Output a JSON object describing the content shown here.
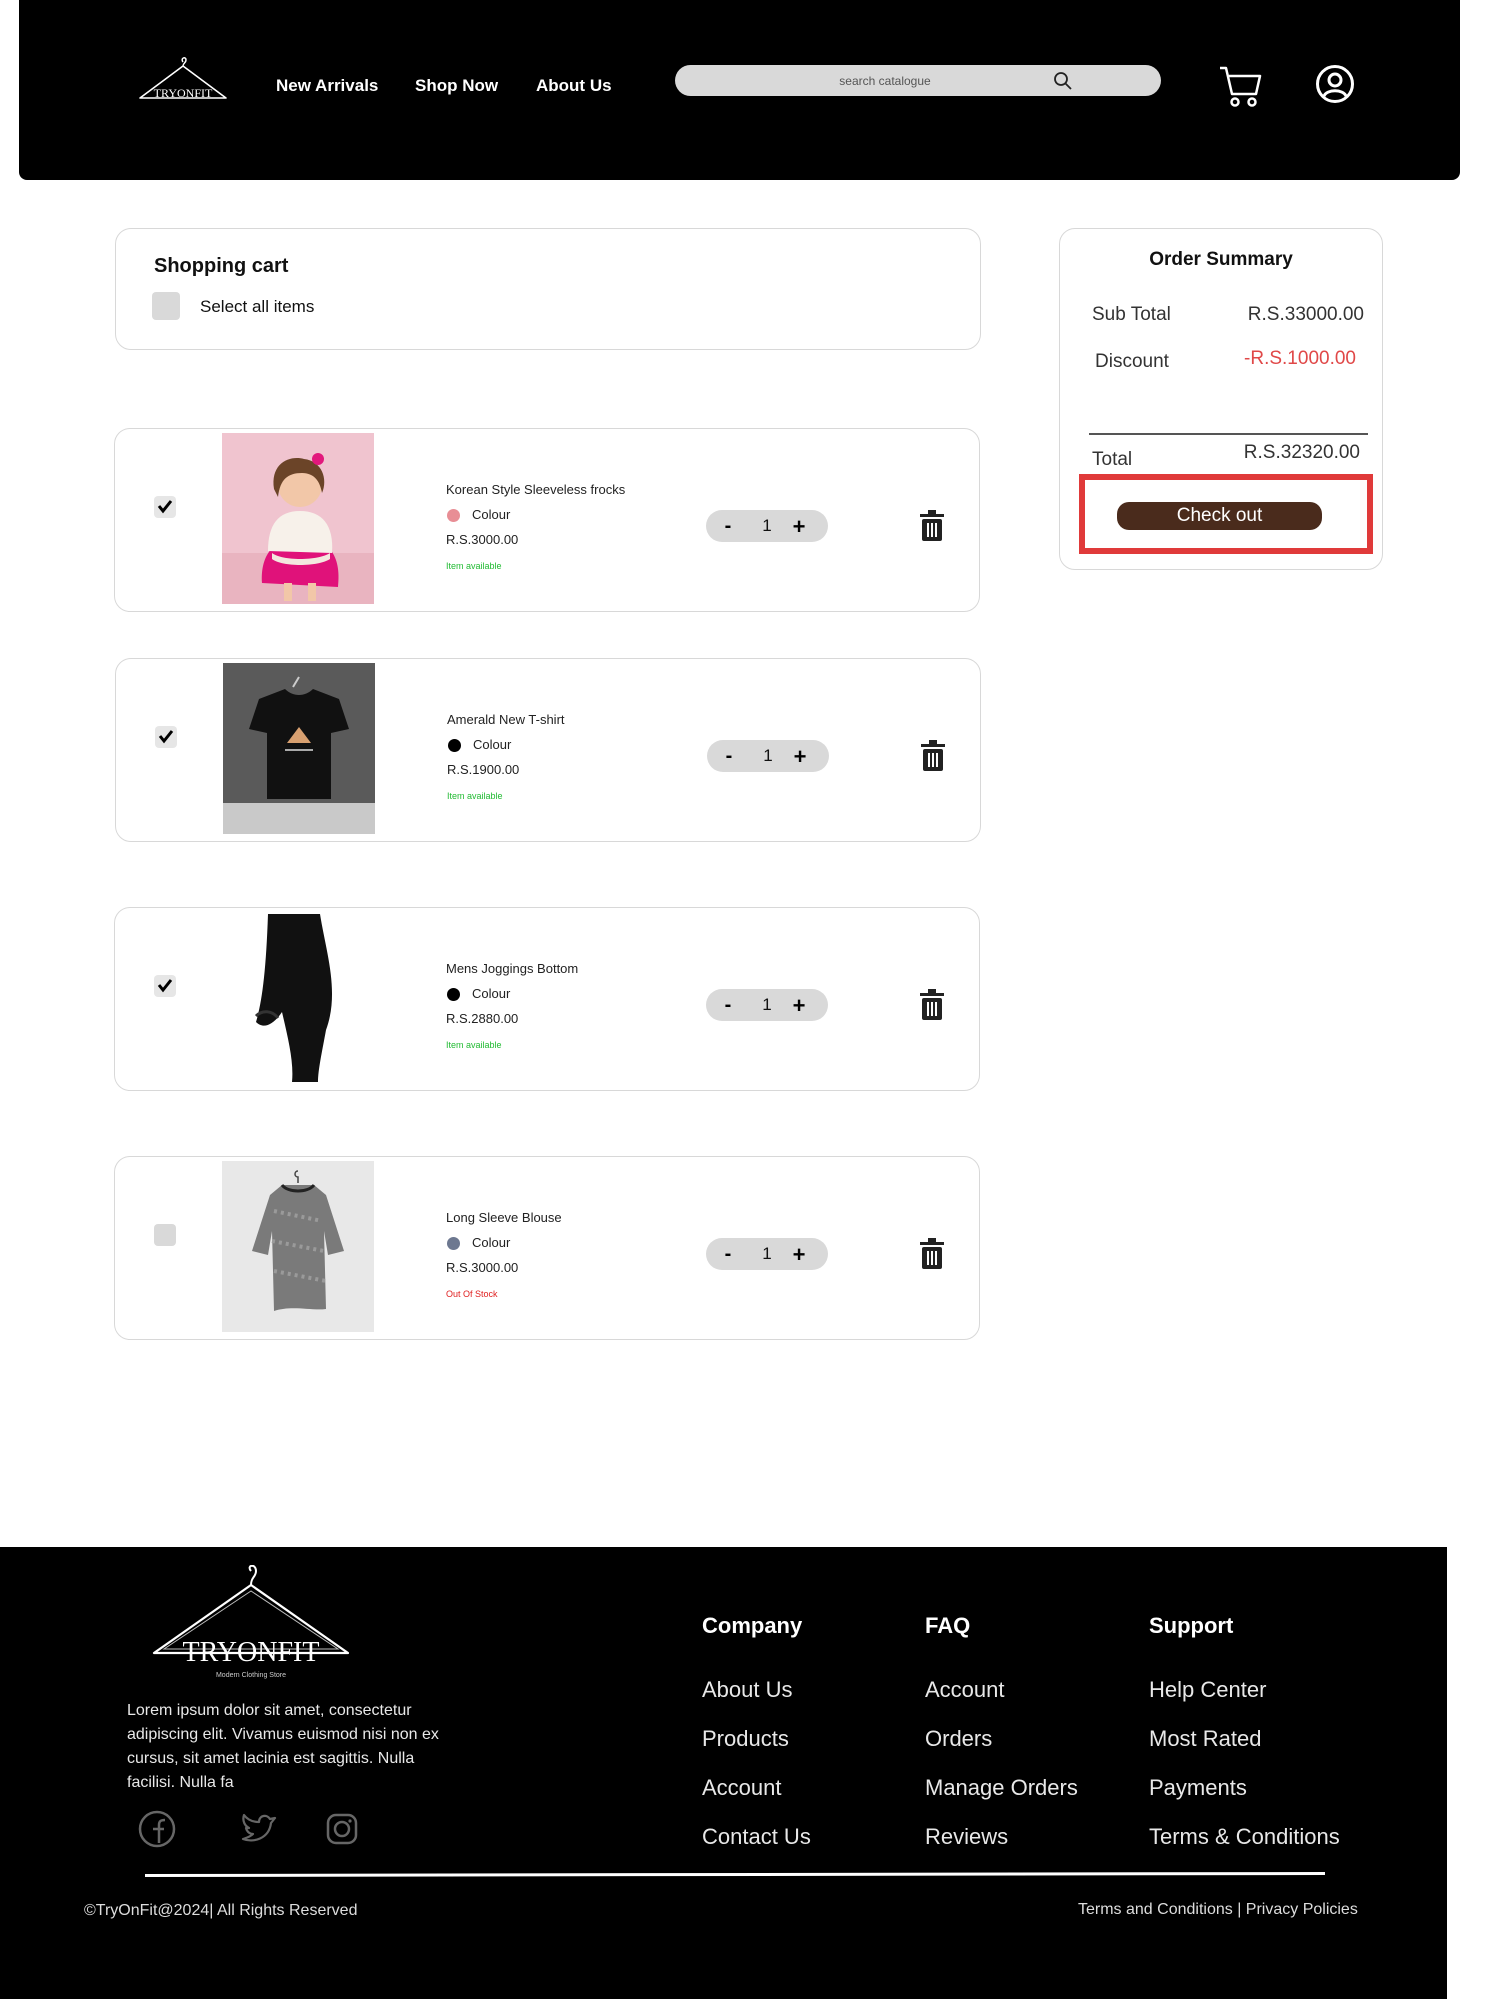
{
  "header": {
    "logo_text": "TRYONFIT",
    "nav": [
      "New Arrivals",
      "Shop Now",
      "About Us"
    ],
    "search_placeholder": "search catalogue"
  },
  "cart": {
    "title": "Shopping cart",
    "select_all_label": "Select all items",
    "colour_label": "Colour",
    "items": [
      {
        "name": "Korean Style Sleeveless frocks",
        "price": "R.S.3000.00",
        "stock": "Item available",
        "stock_color": "#22bb33",
        "swatch": "#e88e95",
        "qty": "1",
        "checked": true
      },
      {
        "name": "Amerald  New T-shirt",
        "price": "R.S.1900.00",
        "stock": "Item available",
        "stock_color": "#22bb33",
        "swatch": "#000000",
        "qty": "1",
        "checked": true
      },
      {
        "name": "Mens Joggings Bottom",
        "price": "R.S.2880.00",
        "stock": "Item available",
        "stock_color": "#22bb33",
        "swatch": "#000000",
        "qty": "1",
        "checked": true
      },
      {
        "name": "Long Sleeve Blouse",
        "price": "R.S.3000.00",
        "stock": "Out Of Stock",
        "stock_color": "#e02020",
        "swatch": "#6d7890",
        "qty": "1",
        "checked": false
      }
    ]
  },
  "summary": {
    "title": "Order Summary",
    "subtotal_label": "Sub Total",
    "subtotal_value": "R.S.33000.00",
    "discount_label": "Discount",
    "discount_value": "-R.S.1000.00",
    "discount_color": "#e04848",
    "total_label": "Total",
    "total_value": "R.S.32320.00",
    "checkout_label": "Check out"
  },
  "footer": {
    "logo_text": "TRYONFIT",
    "logo_tagline": "Modern Clothing Store",
    "blurb": "Lorem ipsum dolor sit amet, consectetur adipiscing elit. Vivamus euismod nisi non ex cursus, sit amet lacinia est sagittis. Nulla facilisi. Nulla fa",
    "social_icons": [
      "facebook-icon",
      "twitter-icon",
      "instagram-icon"
    ],
    "columns": [
      {
        "heading": "Company",
        "links": [
          "About Us",
          "Products",
          "Account",
          "Contact Us"
        ]
      },
      {
        "heading": "FAQ",
        "links": [
          "Account",
          "Orders",
          "Manage Orders",
          "Reviews"
        ]
      },
      {
        "heading": "Support",
        "links": [
          "Help Center",
          "Most Rated",
          "Payments",
          "Terms & Conditions"
        ]
      }
    ],
    "copyright": "©TryOnFit@2024| All Rights Reserved",
    "legal": "Terms and Conditions | Privacy Policies"
  },
  "colors": {
    "header_bg": "#000000",
    "checkout_btn": "#4a2b1c",
    "highlight_frame": "#e03a3a",
    "available": "#22bb33",
    "out_of_stock": "#e02020"
  }
}
